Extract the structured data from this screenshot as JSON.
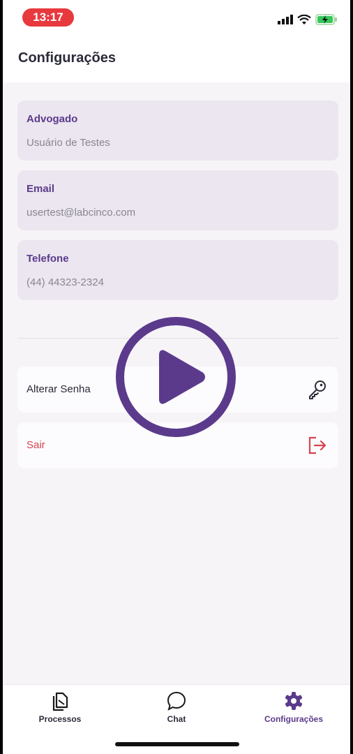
{
  "status_bar": {
    "time": "13:17"
  },
  "header": {
    "title": "Configurações"
  },
  "profile_fields": [
    {
      "label": "Advogado",
      "value": "Usuário de Testes"
    },
    {
      "label": "Email",
      "value": "usertest@labcinco.com"
    },
    {
      "label": "Telefone",
      "value": "(44) 44323-2324"
    }
  ],
  "actions": {
    "change_password": {
      "label": "Alterar Senha",
      "icon": "key-icon"
    },
    "logout": {
      "label": "Sair",
      "icon": "logout-icon"
    }
  },
  "tabs": [
    {
      "label": "Processos",
      "icon": "documents-icon",
      "active": false
    },
    {
      "label": "Chat",
      "icon": "chat-bubble-icon",
      "active": false
    },
    {
      "label": "Configurações",
      "icon": "gear-icon",
      "active": true
    }
  ],
  "colors": {
    "accent": "#5b3a8c",
    "danger": "#d64550",
    "time_pill": "#e8393f",
    "card_bg": "#ebe6ef",
    "screen_bg": "#f7f4f8"
  }
}
